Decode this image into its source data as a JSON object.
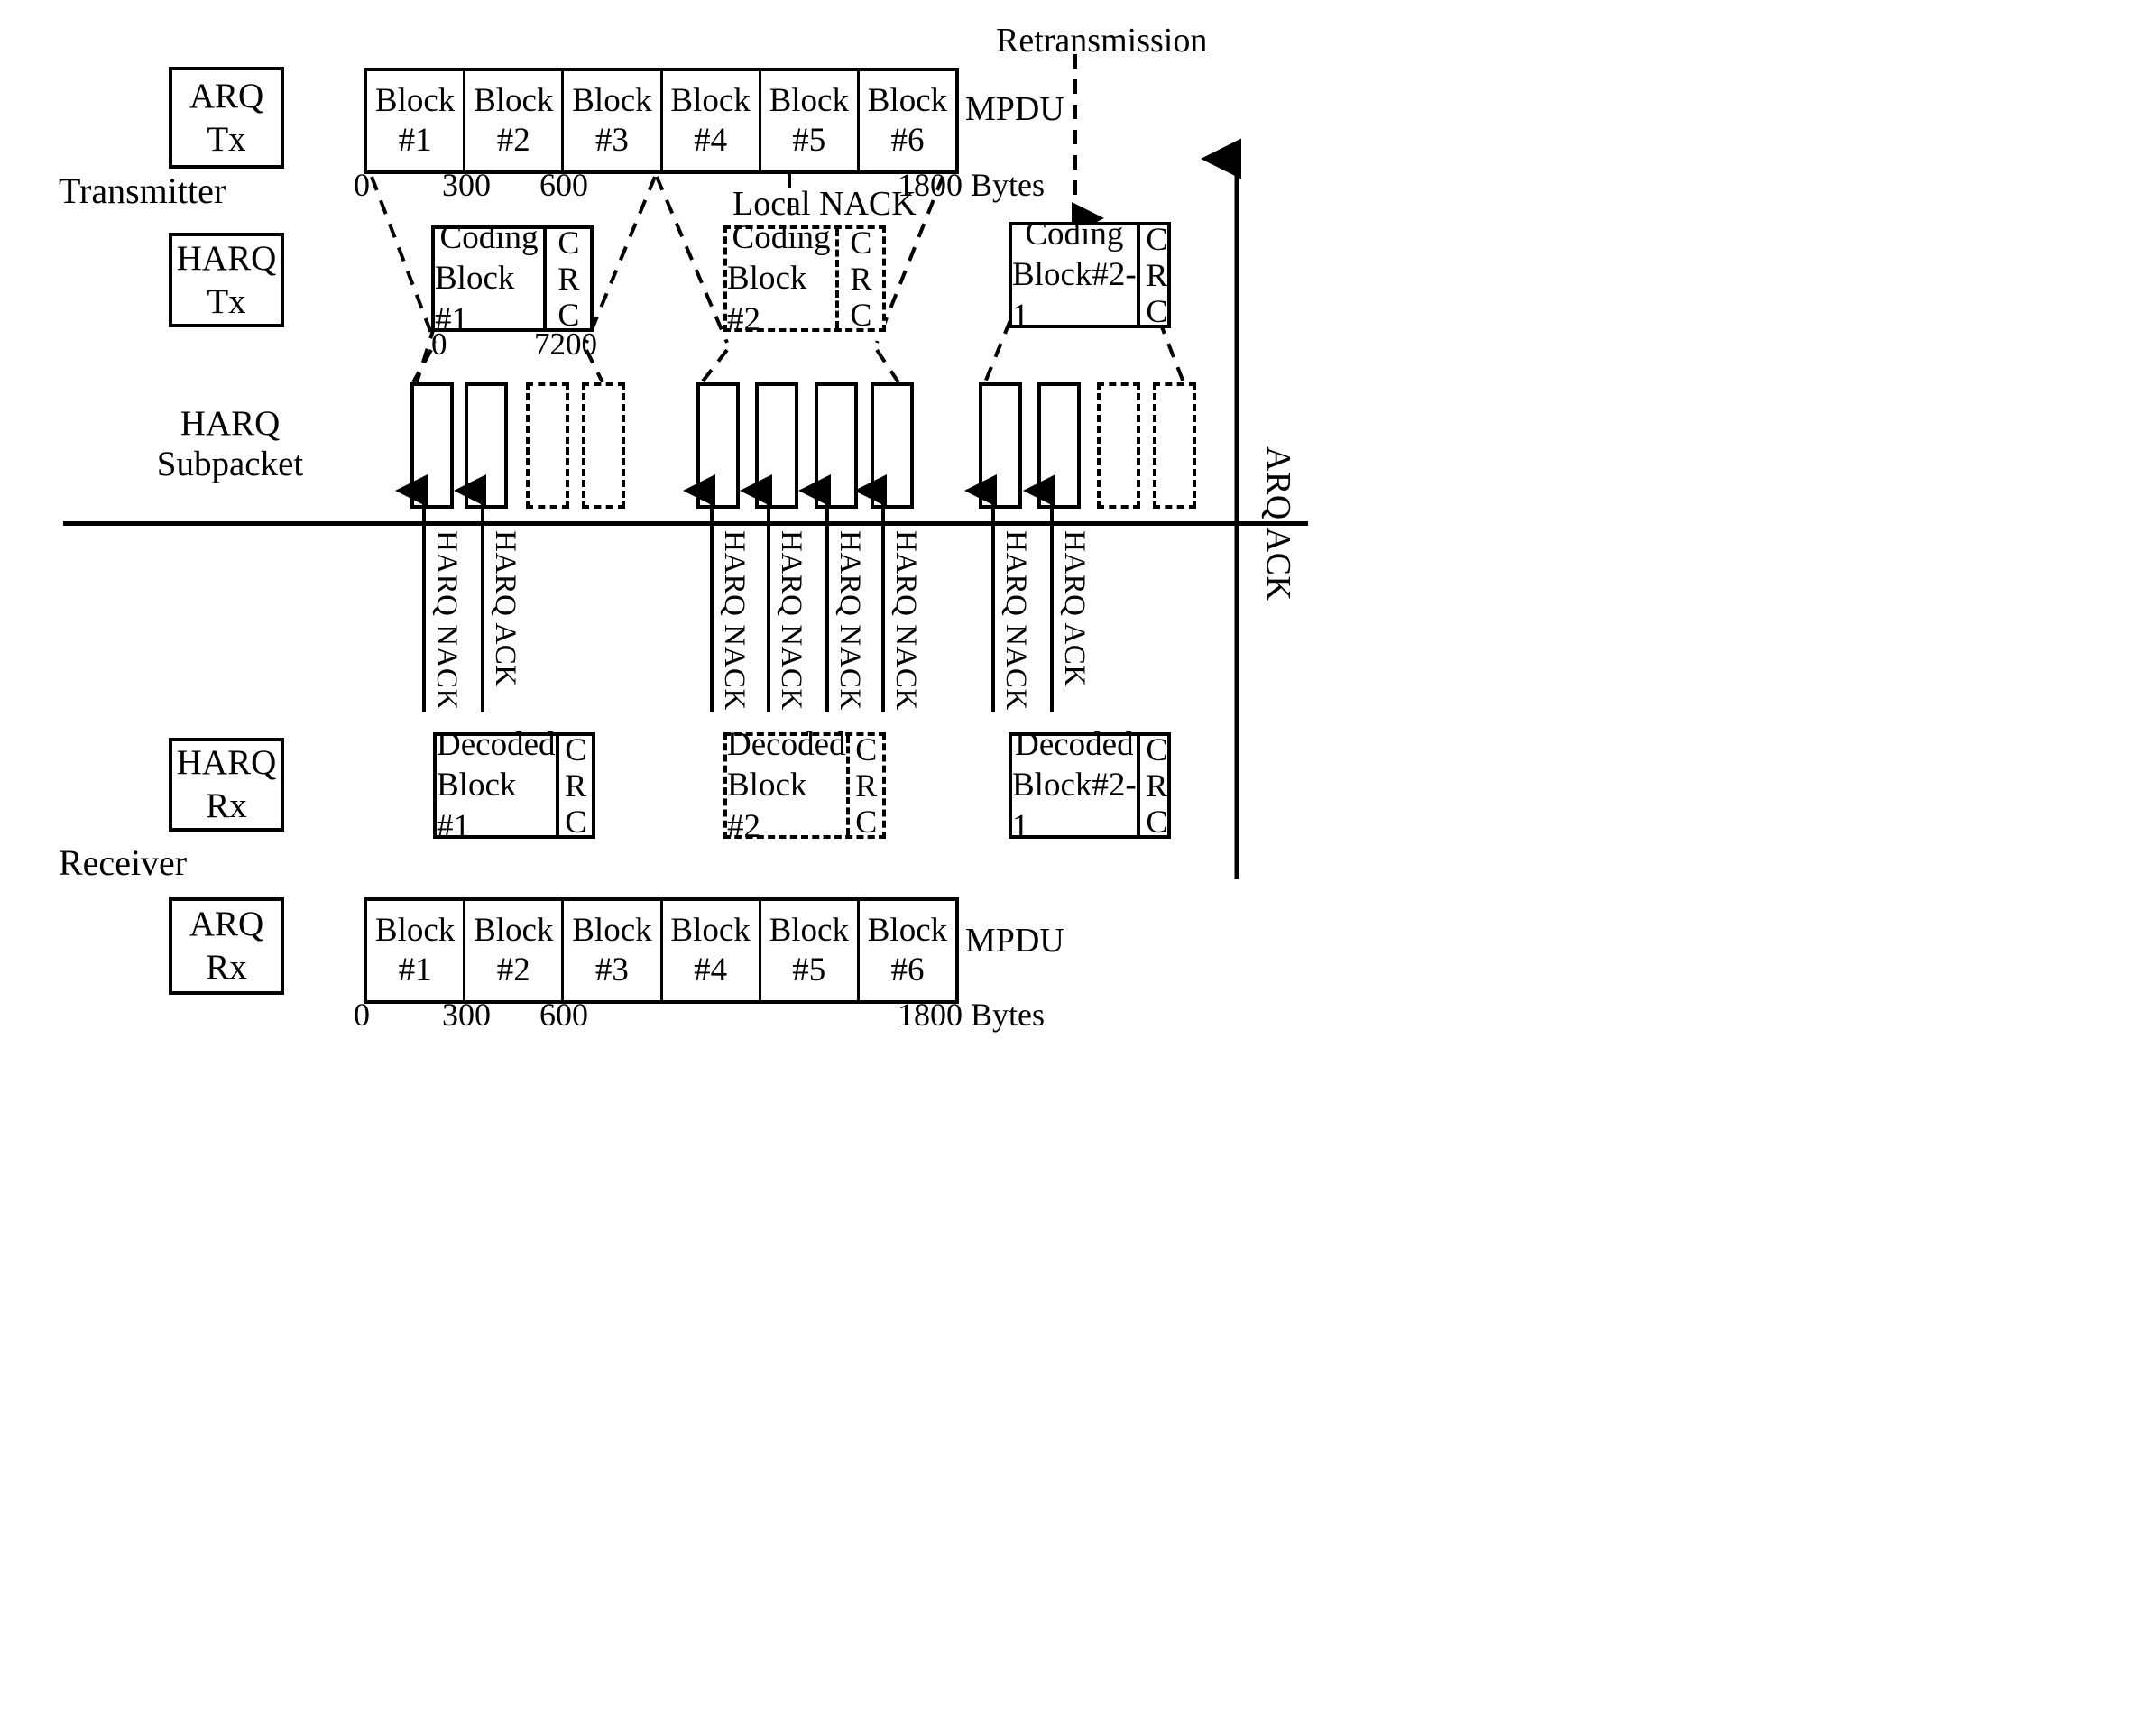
{
  "diagram": {
    "side_labels": {
      "transmitter": "Transmitter",
      "receiver": "Receiver"
    },
    "annotations": {
      "retransmission": "Retransmission",
      "local_nack": "Local NACK",
      "arq_ack": "ARQ ACK"
    },
    "role_boxes": {
      "arq_tx": {
        "line1": "ARQ",
        "line2": "Tx"
      },
      "harq_tx": {
        "line1": "HARQ",
        "line2": "Tx"
      },
      "harq_subpacket": {
        "line1": "HARQ",
        "line2": "Subpacket"
      },
      "harq_rx": {
        "line1": "HARQ",
        "line2": "Rx"
      },
      "arq_rx": {
        "line1": "ARQ",
        "line2": "Rx"
      }
    },
    "mpdu_tx": {
      "label": "MPDU",
      "blocks": [
        {
          "line1": "Block",
          "line2": "#1"
        },
        {
          "line1": "Block",
          "line2": "#2"
        },
        {
          "line1": "Block",
          "line2": "#3"
        },
        {
          "line1": "Block",
          "line2": "#4"
        },
        {
          "line1": "Block",
          "line2": "#5"
        },
        {
          "line1": "Block",
          "line2": "#6"
        }
      ],
      "scale": [
        "0",
        "300",
        "600",
        "1800 Bytes"
      ]
    },
    "mpdu_rx": {
      "label": "MPDU",
      "blocks": [
        {
          "line1": "Block",
          "line2": "#1"
        },
        {
          "line1": "Block",
          "line2": "#2"
        },
        {
          "line1": "Block",
          "line2": "#3"
        },
        {
          "line1": "Block",
          "line2": "#4"
        },
        {
          "line1": "Block",
          "line2": "#5"
        },
        {
          "line1": "Block",
          "line2": "#6"
        }
      ],
      "scale": [
        "0",
        "300",
        "600",
        "1800 Bytes"
      ]
    },
    "coding_blocks": [
      {
        "line1": "Coding",
        "line2": "Block #1",
        "crc": "CRC",
        "style": "solid",
        "scale_left": "0",
        "scale_right": "7200"
      },
      {
        "line1": "Coding",
        "line2": "Block #2",
        "crc": "CRC",
        "style": "dashed",
        "scale_left": "",
        "scale_right": ""
      },
      {
        "line1": "Coding",
        "line2": "Block#2-1",
        "crc": "CRC",
        "style": "solid",
        "scale_left": "",
        "scale_right": ""
      }
    ],
    "decoded_blocks": [
      {
        "line1": "Decoded",
        "line2": "Block #1",
        "crc": "CRC",
        "style": "solid"
      },
      {
        "line1": "Decoded",
        "line2": "Block #2",
        "crc": "CRC",
        "style": "dashed"
      },
      {
        "line1": "Decoded",
        "line2": "Block#2-1",
        "crc": "CRC",
        "style": "solid"
      }
    ],
    "subpacket_groups": [
      {
        "styles": [
          "solid",
          "solid",
          "dashed",
          "dashed"
        ]
      },
      {
        "styles": [
          "solid",
          "solid",
          "solid",
          "solid"
        ]
      },
      {
        "styles": [
          "solid",
          "solid",
          "dashed",
          "dashed"
        ]
      }
    ],
    "feedback": [
      {
        "text": "HARQ NACK"
      },
      {
        "text": "HARQ ACK"
      },
      {
        "text": "HARQ NACK"
      },
      {
        "text": "HARQ NACK"
      },
      {
        "text": "HARQ NACK"
      },
      {
        "text": "HARQ NACK"
      },
      {
        "text": "HARQ NACK"
      },
      {
        "text": "HARQ ACK"
      }
    ]
  }
}
